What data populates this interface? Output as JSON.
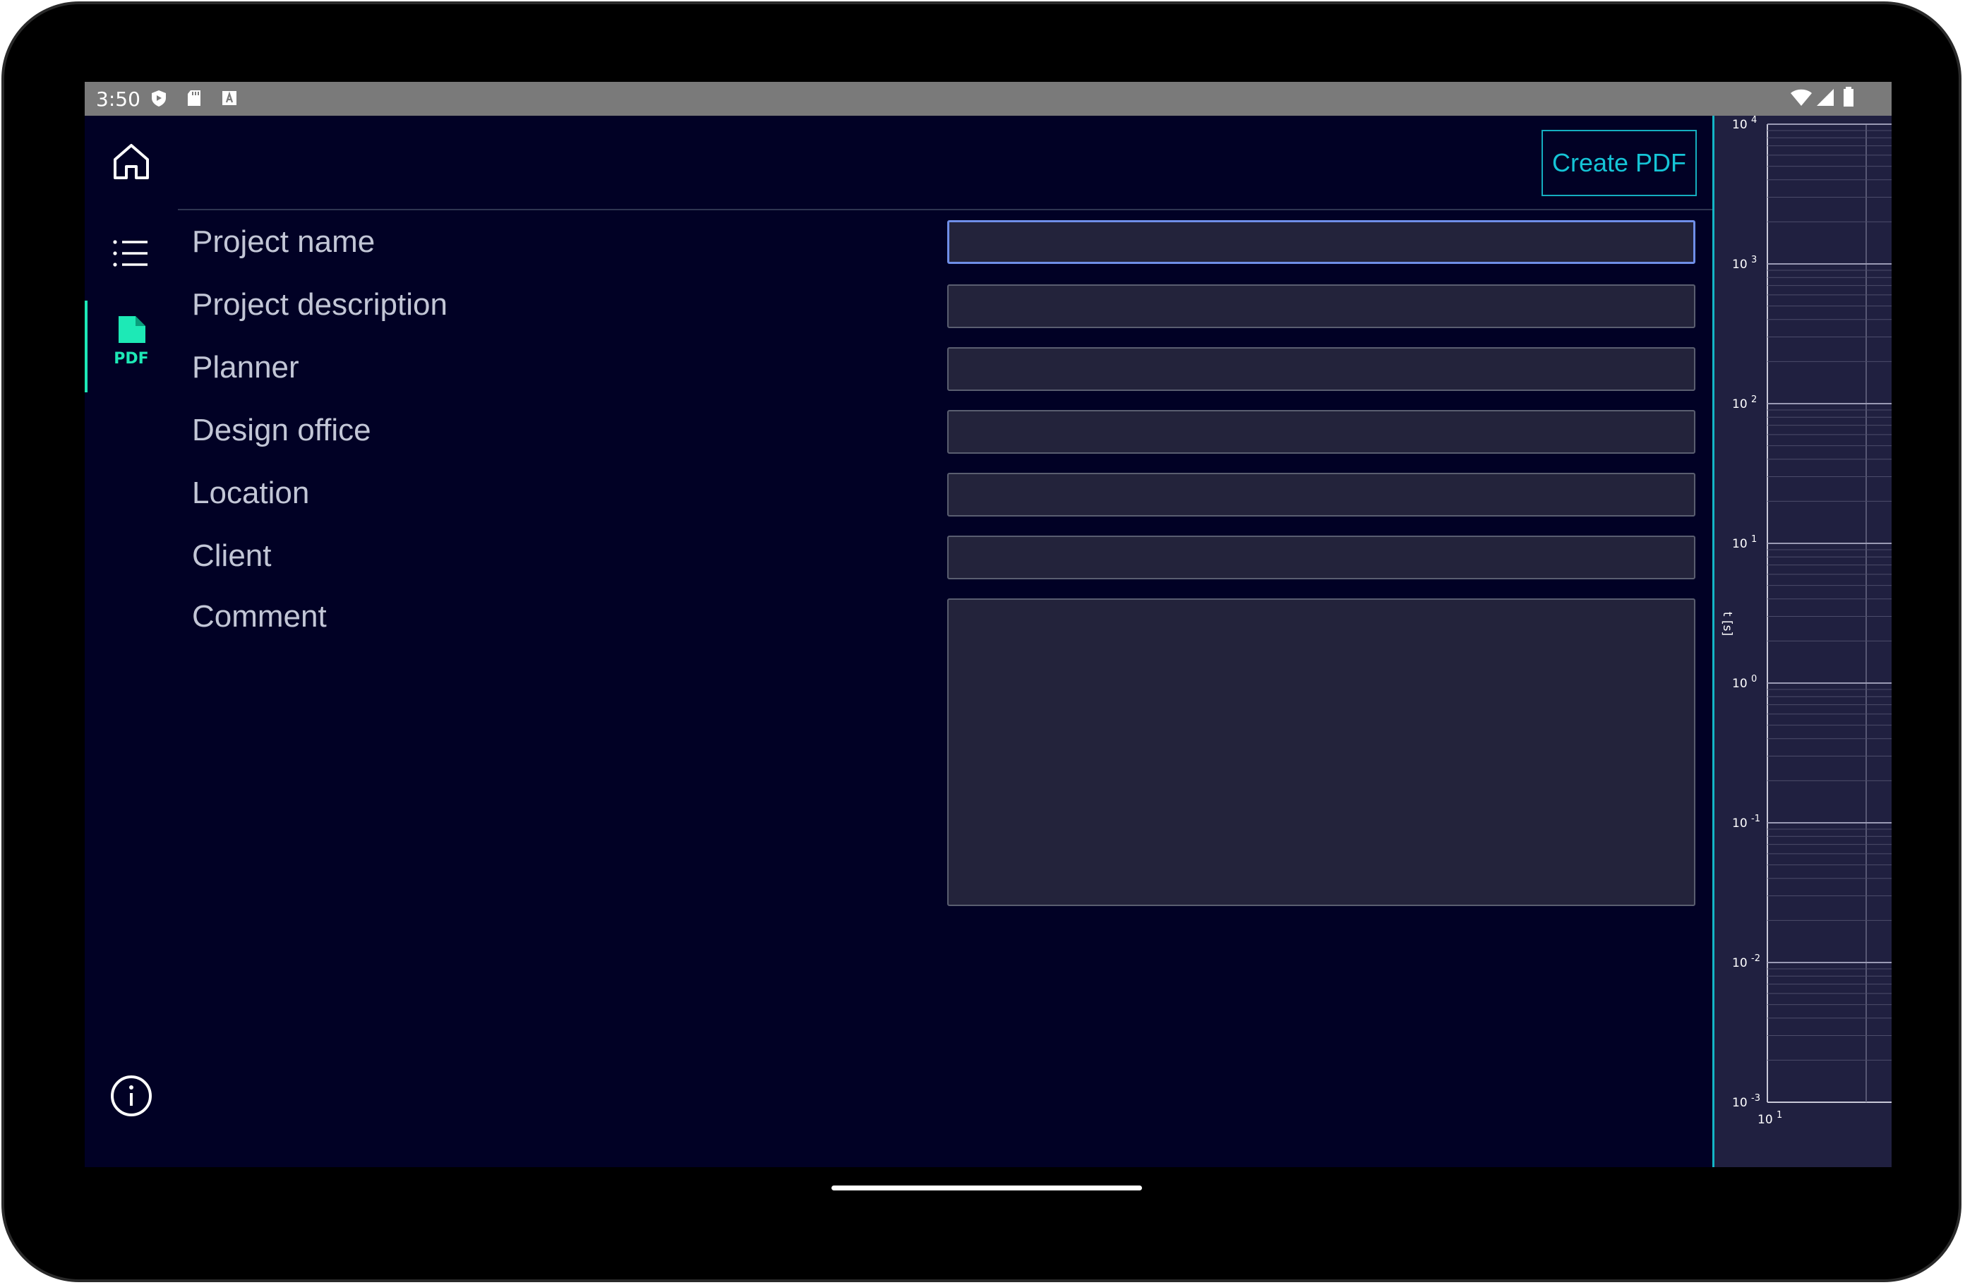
{
  "status_bar": {
    "time": "3:50",
    "left_icons": [
      "play-protect-icon",
      "sd-card-icon",
      "keyboard-a-icon"
    ],
    "right_icons": [
      "wifi-icon",
      "signal-icon",
      "battery-icon"
    ]
  },
  "nav_rail": {
    "items": [
      {
        "name": "home",
        "icon": "home-icon"
      },
      {
        "name": "list",
        "icon": "list-icon"
      },
      {
        "name": "pdf",
        "icon": "pdf-file-icon",
        "label": "PDF",
        "selected": true
      },
      {
        "name": "info",
        "icon": "info-icon"
      }
    ],
    "accent_color": "#1de9b6"
  },
  "toolbar": {
    "create_pdf_label": "Create PDF"
  },
  "form": {
    "fields": [
      {
        "label": "Project name",
        "value": ""
      },
      {
        "label": "Project description",
        "value": ""
      },
      {
        "label": "Planner",
        "value": ""
      },
      {
        "label": "Design office",
        "value": ""
      },
      {
        "label": "Location",
        "value": ""
      },
      {
        "label": "Client",
        "value": ""
      },
      {
        "label": "Comment",
        "value": ""
      }
    ]
  },
  "chart_data": {
    "type": "line",
    "ylabel": "t [s]",
    "yscale": "log",
    "ylim": [
      0.001,
      10000
    ],
    "y_ticks": [
      "10 4",
      "10 3",
      "10 2",
      "10 1",
      "10 0",
      "10 -1",
      "10 -2",
      "10 -3"
    ],
    "x_ticks": [
      "10 1"
    ],
    "grid": true,
    "series": []
  },
  "colors": {
    "background": "#010125",
    "field_bg": "#23233b",
    "accent_teal": "#15aebf",
    "label_text": "#c2c6d6"
  }
}
